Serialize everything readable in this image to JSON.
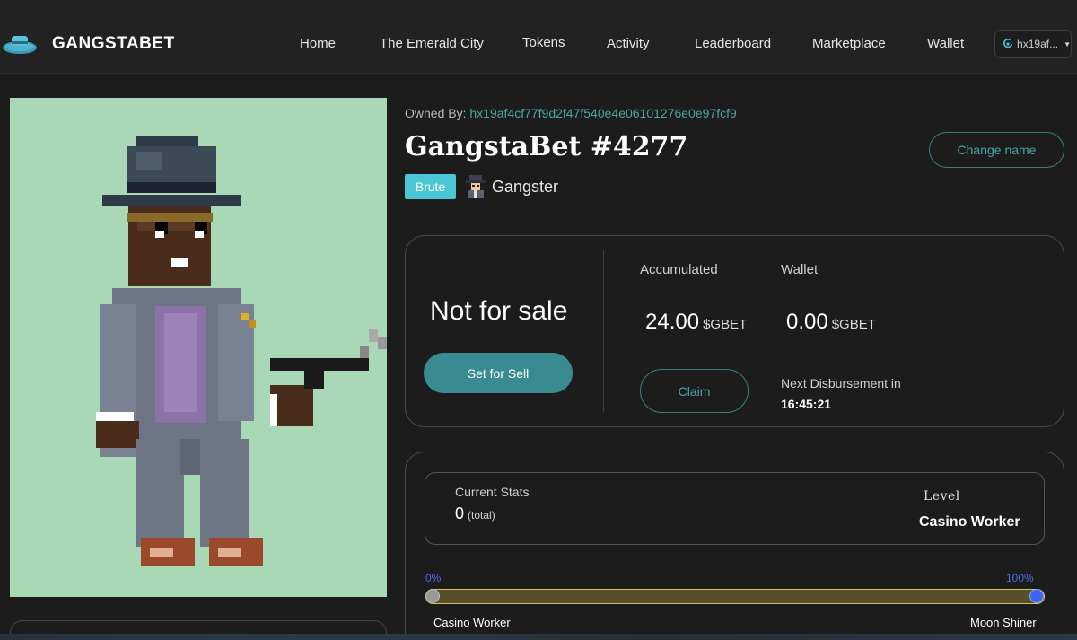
{
  "header": {
    "brand": "GANGSTABET",
    "nav": [
      {
        "label": "Home"
      },
      {
        "label": "The Emerald City"
      },
      {
        "label": "Tokens"
      },
      {
        "label": "Activity"
      },
      {
        "label": "Leaderboard"
      },
      {
        "label": "Marketplace"
      },
      {
        "label": "Wallet"
      }
    ],
    "wallet_short": "hx19af...",
    "wallet_icon": "icon-logo-icon"
  },
  "nft": {
    "owned_by_label": "Owned By:",
    "owner_address": "hx19af4cf77f9d2f47f540e4e06101276e0e97fcf9",
    "title": "GangstaBet #4277",
    "change_name_label": "Change name",
    "class_badge": "Brute",
    "role": "Gangster",
    "role_icon": "spy-icon",
    "image_bg": "#a8d8b5"
  },
  "sale": {
    "status": "Not for sale",
    "sell_button": "Set for Sell",
    "accumulated_label": "Accumulated",
    "accumulated_value": "24.00",
    "accumulated_unit": "$GBET",
    "wallet_label": "Wallet",
    "wallet_value": "0.00",
    "wallet_unit": "$GBET",
    "claim_button": "Claim",
    "next_label": "Next Disbursement in",
    "next_time": "16:45:21"
  },
  "stats": {
    "current_label": "Current Stats",
    "current_value": "0",
    "current_suffix": "(total)",
    "level_label": "Level",
    "level_value": "Casino Worker",
    "progress_start_label": "0%",
    "progress_end_label": "100%",
    "progress_fraction": 1.0,
    "rank_start": "Casino Worker",
    "rank_end": "Moon Shiner"
  },
  "colors": {
    "accent": "#3a8b91",
    "teal_text": "#4aa6a8",
    "badge": "#4bc6d4",
    "progress_border": "#d4c461",
    "progress_end_dot": "#3f66f0"
  }
}
